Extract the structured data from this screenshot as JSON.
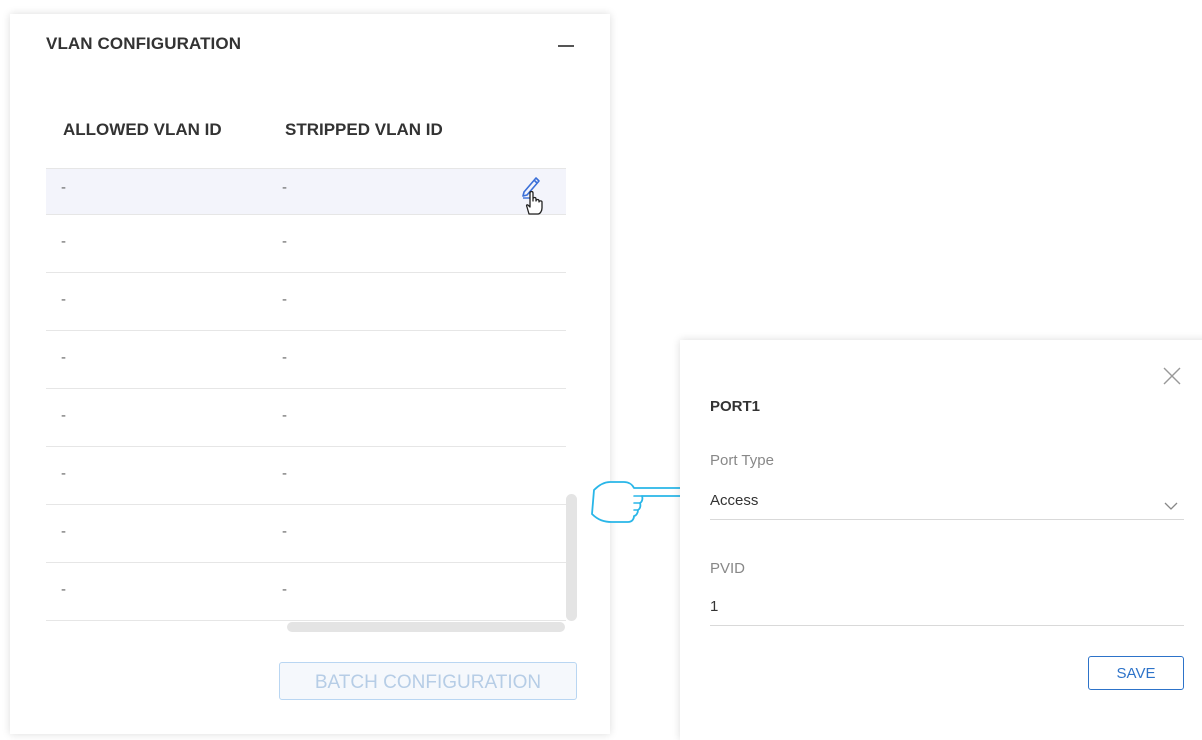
{
  "panel": {
    "title": "VLAN CONFIGURATION"
  },
  "table": {
    "columns": [
      "ALLOWED VLAN ID",
      "STRIPPED VLAN ID"
    ],
    "rows": [
      [
        "-",
        "-"
      ],
      [
        "-",
        "-"
      ],
      [
        "-",
        "-"
      ],
      [
        "-",
        "-"
      ],
      [
        "-",
        "-"
      ],
      [
        "-",
        "-"
      ],
      [
        "-",
        "-"
      ],
      [
        "-",
        "-"
      ]
    ]
  },
  "batch_button": "BATCH CONFIGURATION",
  "modal": {
    "title": "PORT1",
    "port_type_label": "Port Type",
    "port_type_value": "Access",
    "pvid_label": "PVID",
    "pvid_value": "1",
    "save_label": "SAVE"
  },
  "icons": {
    "collapse": "minus-icon",
    "edit": "pencil-icon",
    "cursor": "hand-cursor-icon",
    "pointer": "pointing-hand-icon",
    "close": "close-icon",
    "dropdown": "chevron-down-icon"
  },
  "colors": {
    "accent": "#2d73c9",
    "edit_icon": "#3a6fd8",
    "pointer_outline": "#29b6e8",
    "row_hover": "#f3f4fb"
  }
}
